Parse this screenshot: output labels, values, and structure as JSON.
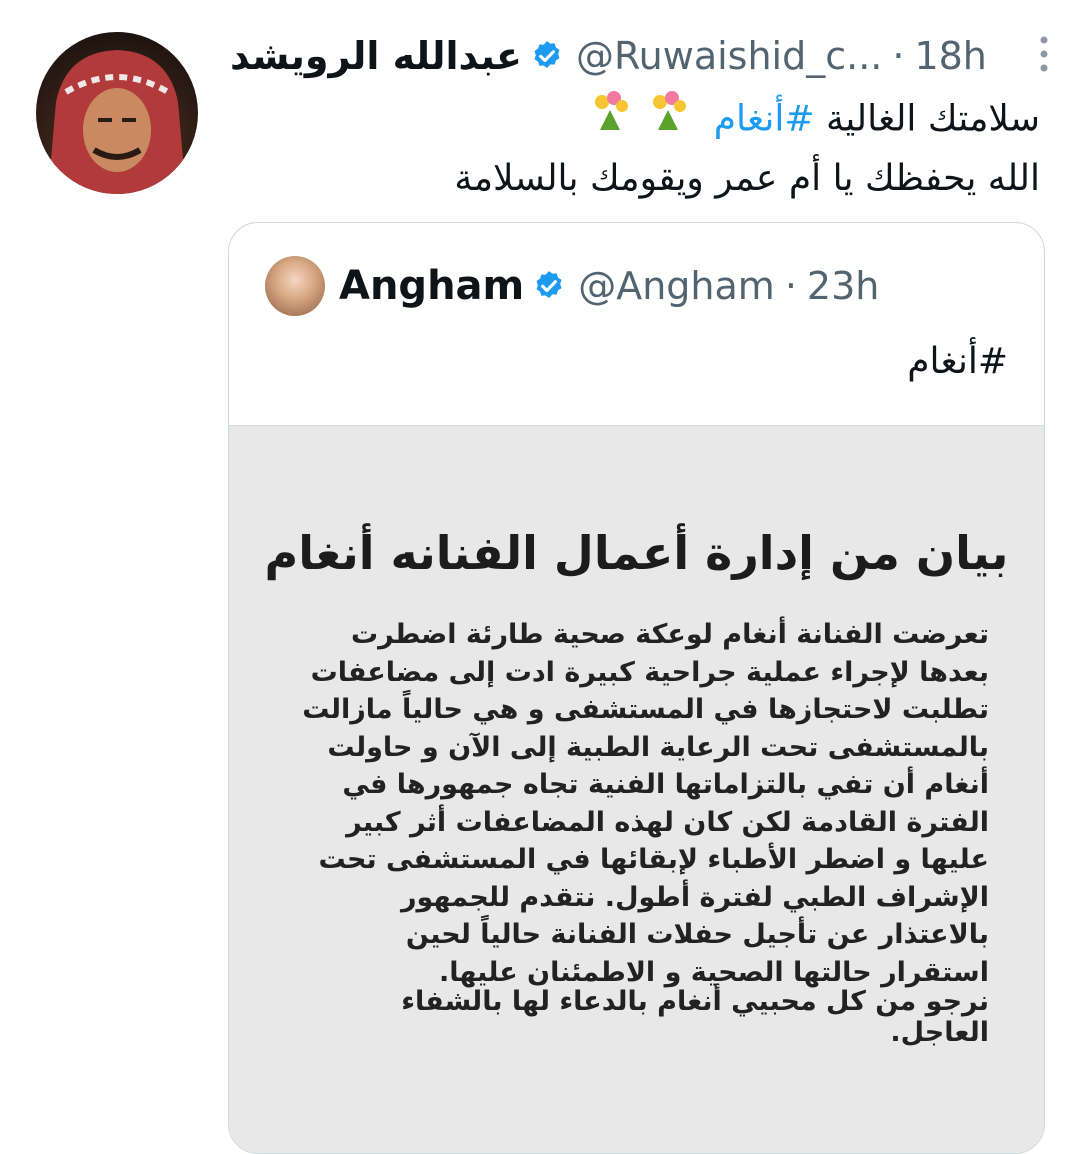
{
  "tweet": {
    "author_name": "عبدالله الرويشد",
    "handle": "@Ruwaishid_c...",
    "separator": "·",
    "time": "18h",
    "line1_text": "سلامتك الغالية",
    "line1_hashtag": "#أنغام",
    "line2": "الله يحفظك يا أم عمر ويقومك بالسلامة"
  },
  "quote": {
    "author_name": "Angham",
    "handle": "@Angham",
    "separator": "·",
    "time": "23h",
    "hashtag": "#أنغام",
    "statement": {
      "title": "بيان من إدارة أعمال الفنانه أنغام",
      "body": "تعرضت الفنانة أنغام لوعكة صحية طارئة اضطرت بعدها لإجراء عملية جراحية كبيرة ادت إلى مضاعفات تطلبت لاحتجازها في المستشفى و هي حالياً مازالت بالمستشفى تحت الرعاية الطبية إلى الآن و حاولت أنغام أن تفي بالتزاماتها الفنية تجاه جمهورها في الفترة القادمة لكن كان لهذه المضاعفات أثر كبير عليها و اضطر الأطباء لإبقائها في المستشفى تحت الإشراف الطبي لفترة أطول. نتقدم للجمهور بالاعتذار عن تأجيل حفلات الفنانة حالياً لحين استقرار حالتها الصحية و الاطمئنان عليها.",
      "footer": "نرجو من كل محبيي أنغام بالدعاء لها بالشفاء العاجل."
    }
  },
  "colors": {
    "accent": "#1d9bf0",
    "secondary_text": "#536471",
    "border": "#cfd9de"
  },
  "icons": {
    "verified": "verified-badge-icon",
    "more": "more-options-icon",
    "flowers": "bouquet-emoji-icon"
  }
}
